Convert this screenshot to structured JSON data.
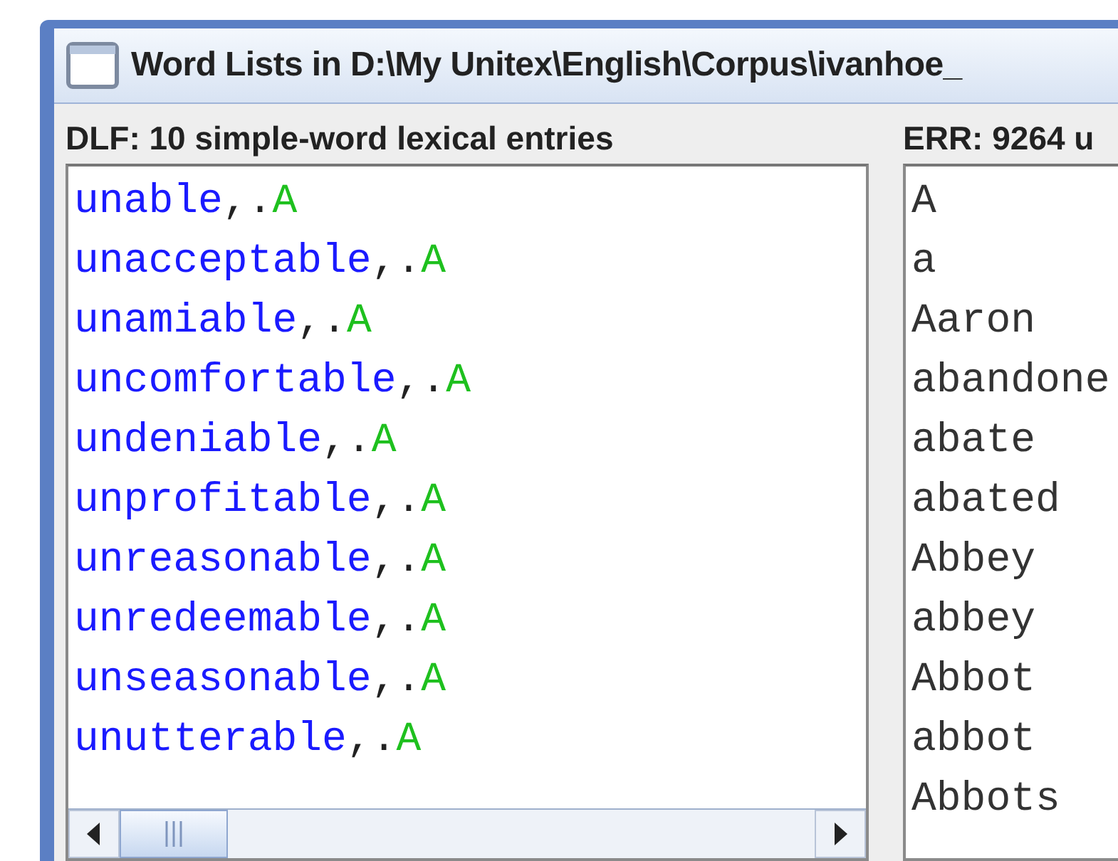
{
  "window": {
    "title": "Word Lists in D:\\My Unitex\\English\\Corpus\\ivanhoe_"
  },
  "dlf": {
    "label": "DLF: 10 simple-word lexical entries",
    "entries": [
      {
        "lemma": "unable",
        "separator": ",.",
        "code": "A"
      },
      {
        "lemma": "unacceptable",
        "separator": ",.",
        "code": "A"
      },
      {
        "lemma": "unamiable",
        "separator": ",.",
        "code": "A"
      },
      {
        "lemma": "uncomfortable",
        "separator": ",.",
        "code": "A"
      },
      {
        "lemma": "undeniable",
        "separator": ",.",
        "code": "A"
      },
      {
        "lemma": "unprofitable",
        "separator": ",.",
        "code": "A"
      },
      {
        "lemma": "unreasonable",
        "separator": ",.",
        "code": "A"
      },
      {
        "lemma": "unredeemable",
        "separator": ",.",
        "code": "A"
      },
      {
        "lemma": "unseasonable",
        "separator": ",.",
        "code": "A"
      },
      {
        "lemma": "unutterable",
        "separator": ",.",
        "code": "A"
      }
    ]
  },
  "err": {
    "label": "ERR: 9264 u",
    "words": [
      "A",
      "a",
      "Aaron",
      "abandone",
      "abate",
      "abated",
      "Abbey",
      "abbey",
      "Abbot",
      "abbot",
      "Abbots"
    ]
  }
}
